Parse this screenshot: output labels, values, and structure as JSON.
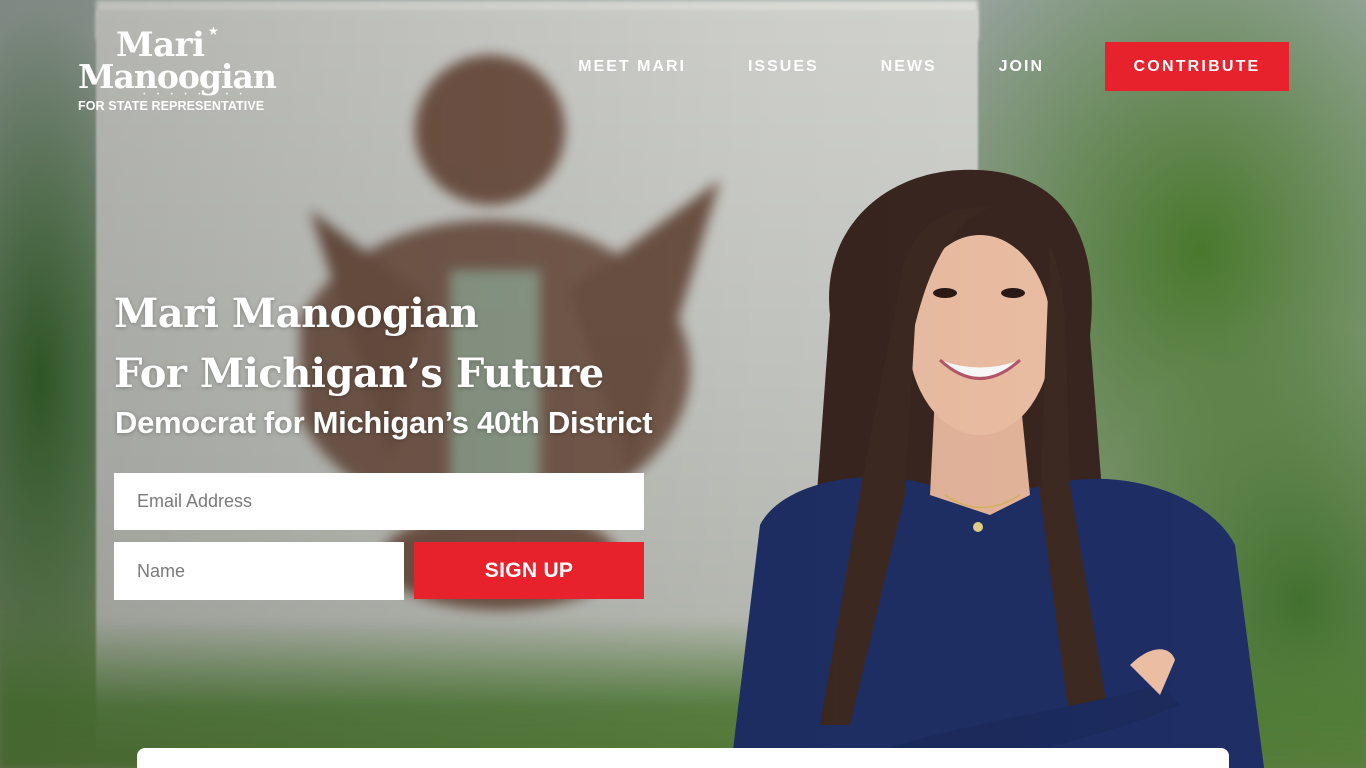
{
  "logo": {
    "line1": "Mari",
    "line2": "Manoogian",
    "dots": "• • • • • • • •",
    "line3": "FOR STATE REPRESENTATIVE"
  },
  "nav": {
    "items": [
      {
        "label": "MEET MARI"
      },
      {
        "label": "ISSUES"
      },
      {
        "label": "NEWS"
      },
      {
        "label": "JOIN"
      }
    ],
    "contribute_label": "CONTRIBUTE"
  },
  "hero": {
    "title_line1": "Mari Manoogian",
    "title_line2": "For Michigan’s Future",
    "subtitle": "Democrat for Michigan’s 40th District"
  },
  "signup_form": {
    "email_placeholder": "Email Address",
    "name_placeholder": "Name",
    "submit_label": "SIGN UP"
  },
  "colors": {
    "accent": "#e8222d",
    "text_on_hero": "#ffffff"
  }
}
